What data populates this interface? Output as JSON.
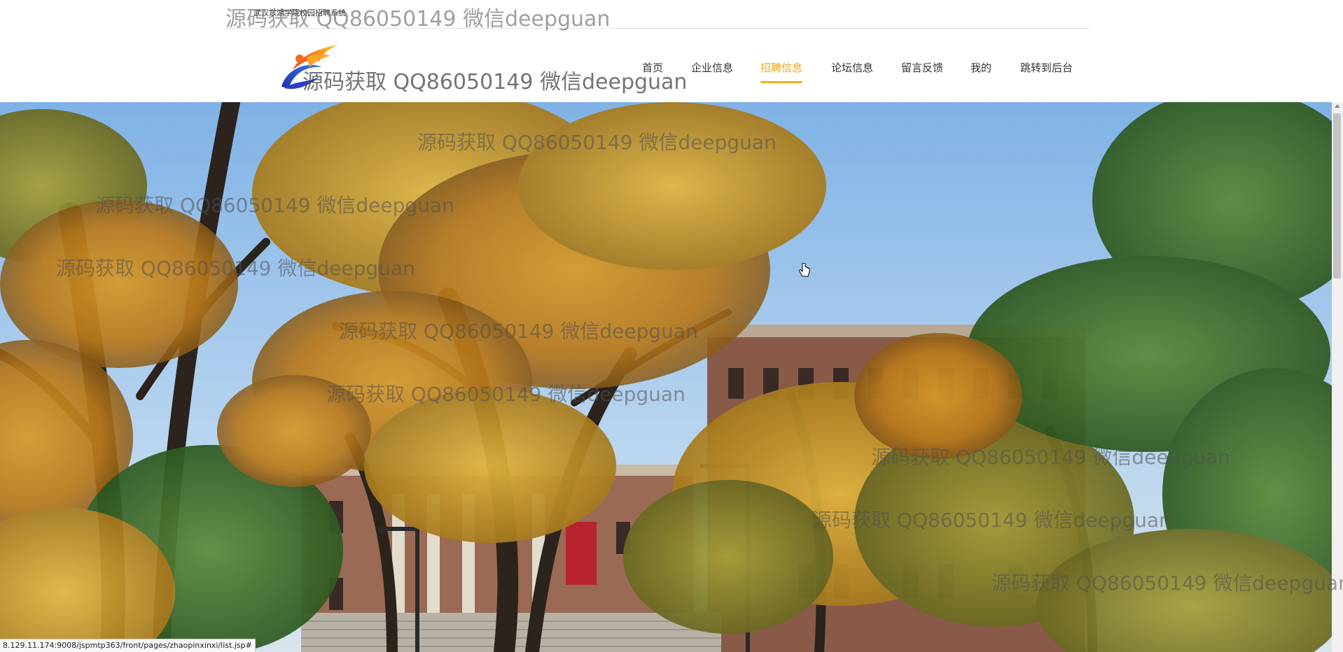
{
  "site": {
    "title_small": "武汉东湖学院校园招聘系统"
  },
  "nav": {
    "items": [
      {
        "label": "首页",
        "active": false
      },
      {
        "label": "企业信息",
        "active": false
      },
      {
        "label": "招聘信息",
        "active": true
      },
      {
        "label": "论坛信息",
        "active": false
      },
      {
        "label": "留言反馈",
        "active": false
      },
      {
        "label": "我的",
        "active": false
      },
      {
        "label": "跳转到后台",
        "active": false
      }
    ]
  },
  "watermark": {
    "text": "源码获取 QQ86050149 微信deepguan"
  },
  "statusbar": {
    "url": "8.129.11.174:9008/jspmtp363/front/pages/zhaopinxinxi/list.jsp#"
  },
  "colors": {
    "accent": "#f2a31c",
    "nav_text": "#333333",
    "sky": "#9cc6ee"
  }
}
